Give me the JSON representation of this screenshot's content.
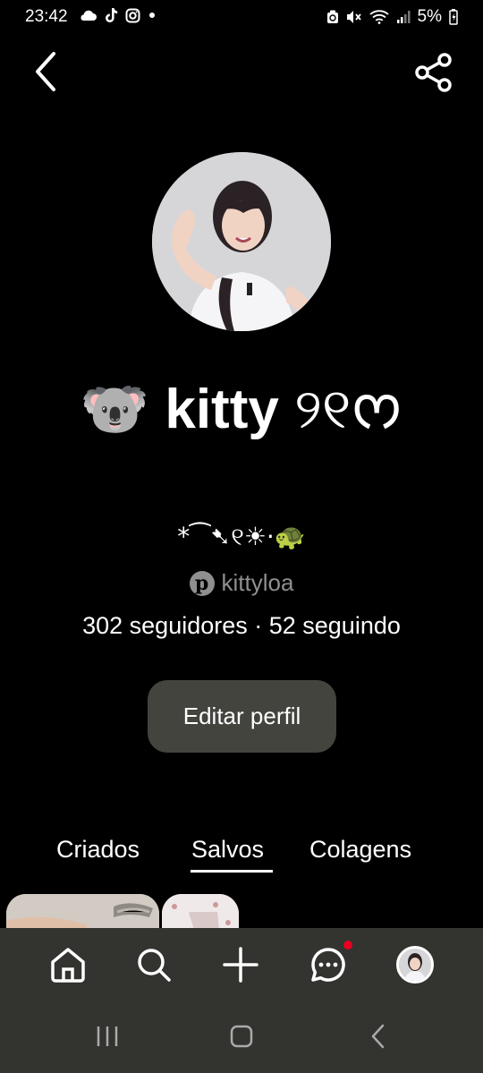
{
  "status_bar": {
    "time": "23:42",
    "battery": "5%",
    "left_icons": [
      "cloud-icon",
      "tiktok-icon",
      "instagram-icon",
      "dot-icon"
    ],
    "right_icons": [
      "recycle-icon",
      "mute-icon",
      "wifi-icon",
      "signal-icon",
      "battery-icon"
    ]
  },
  "profile": {
    "name_emoji": "🐨",
    "name": "kitty",
    "name_suffix": "୨୧ᰔ",
    "bio": "*⁀➷୧☀︎·🐢",
    "username": "kittyloa",
    "stats": "302 seguidores · 52 seguindo",
    "edit_button": "Editar perfil"
  },
  "tabs": [
    {
      "label": "Criados",
      "active": false
    },
    {
      "label": "Salvos",
      "active": true
    },
    {
      "label": "Colagens",
      "active": false
    }
  ],
  "bottom_nav": {
    "items": [
      "home-icon",
      "search-icon",
      "plus-icon",
      "messages-icon",
      "profile-avatar"
    ],
    "has_message_notification": true
  },
  "colors": {
    "background": "#000000",
    "button_bg": "#44443f",
    "nav_bg": "#333330",
    "muted_text": "#8f8f8f",
    "notification": "#e60023"
  }
}
